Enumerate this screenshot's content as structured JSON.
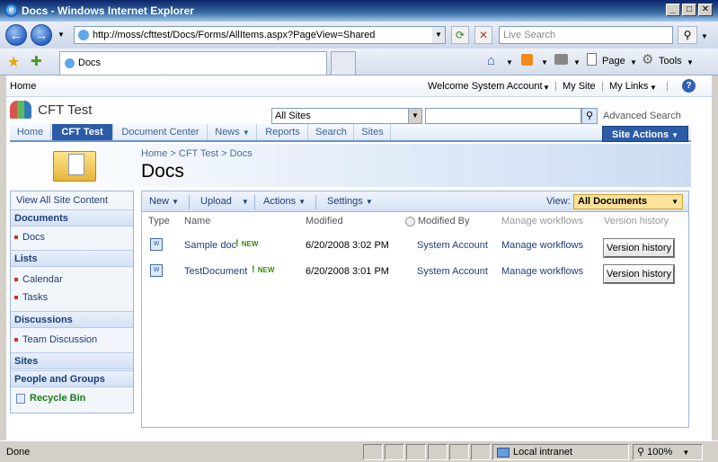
{
  "window": {
    "title": "Docs - Windows Internet Explorer"
  },
  "browser": {
    "address": "http://moss/cfttest/Docs/Forms/AllItems.aspx?PageView=Shared",
    "search_placeholder": "Live Search",
    "tab_title": "Docs",
    "page_menu": "Page",
    "tools_menu": "Tools"
  },
  "sharepoint": {
    "top_left": "Home",
    "welcome": "Welcome System Account",
    "my_site": "My Site",
    "my_links": "My Links",
    "site_title": "CFT Test",
    "search_scope": "All Sites",
    "advanced_search": "Advanced Search",
    "nav": [
      "Home",
      "CFT Test",
      "Document Center",
      "News",
      "Reports",
      "Search",
      "Sites"
    ],
    "site_actions": "Site Actions",
    "breadcrumb": "Home > CFT Test > Docs",
    "page_title": "Docs"
  },
  "leftnav": {
    "view_all": "View All Site Content",
    "documents_head": "Documents",
    "documents_items": [
      "Docs"
    ],
    "lists_head": "Lists",
    "lists_items": [
      "Calendar",
      "Tasks"
    ],
    "discussions_head": "Discussions",
    "discussions_items": [
      "Team Discussion"
    ],
    "sites_head": "Sites",
    "people_head": "People and Groups",
    "recycle": "Recycle Bin"
  },
  "toolbar": {
    "new": "New",
    "upload": "Upload",
    "actions": "Actions",
    "settings": "Settings",
    "view_label": "View:",
    "view_value": "All Documents"
  },
  "list": {
    "columns": [
      "Type",
      "Name",
      "Modified",
      "Modified By",
      "Manage workflows",
      "Version history"
    ],
    "rows": [
      {
        "name": "Sample doc",
        "new": "NEW",
        "modified": "6/20/2008 3:02 PM",
        "modified_by": "System Account",
        "workflow": "Manage workflows",
        "version": "Version history"
      },
      {
        "name": "TestDocument",
        "new": "NEW",
        "modified": "6/20/2008 3:01 PM",
        "modified_by": "System Account",
        "workflow": "Manage workflows",
        "version": "Version history"
      }
    ]
  },
  "status": {
    "left": "Done",
    "zone": "Local intranet",
    "zoom": "100%"
  }
}
